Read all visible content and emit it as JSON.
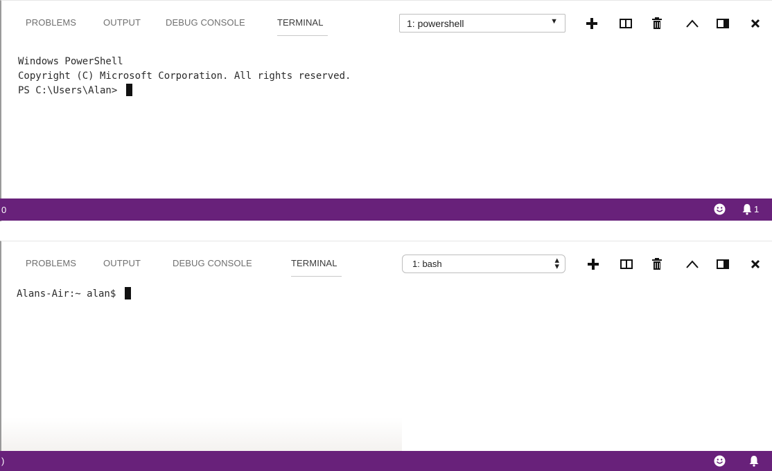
{
  "panels": [
    {
      "tabs": [
        {
          "label": "PROBLEMS"
        },
        {
          "label": "OUTPUT"
        },
        {
          "label": "DEBUG CONSOLE"
        },
        {
          "label": "TERMINAL",
          "active": true
        }
      ],
      "terminal_select": {
        "value": "1: powershell"
      },
      "actions": [
        "plus-icon",
        "split-icon",
        "trash-icon",
        "chevron-up-icon",
        "maximize-panel-icon",
        "close-icon"
      ],
      "terminal_lines": [
        "Windows PowerShell",
        "Copyright (C) Microsoft Corporation. All rights reserved.",
        "",
        "PS C:\\Users\\Alan> "
      ],
      "status": {
        "left": "0",
        "notifications": "1"
      }
    },
    {
      "tabs": [
        {
          "label": "PROBLEMS"
        },
        {
          "label": "OUTPUT"
        },
        {
          "label": "DEBUG CONSOLE"
        },
        {
          "label": "TERMINAL",
          "active": true
        }
      ],
      "terminal_select": {
        "value": "1: bash"
      },
      "actions": [
        "plus-icon",
        "split-icon",
        "trash-icon",
        "chevron-up-icon",
        "maximize-panel-icon",
        "close-icon"
      ],
      "terminal_lines": [
        "Alans-Air:~ alan$ "
      ],
      "status": {
        "left": ")",
        "notifications": ""
      }
    }
  ],
  "colors": {
    "statusbar": "#68217a",
    "text": "#2b2b2b",
    "tab_inactive": "#6f6f6f"
  }
}
